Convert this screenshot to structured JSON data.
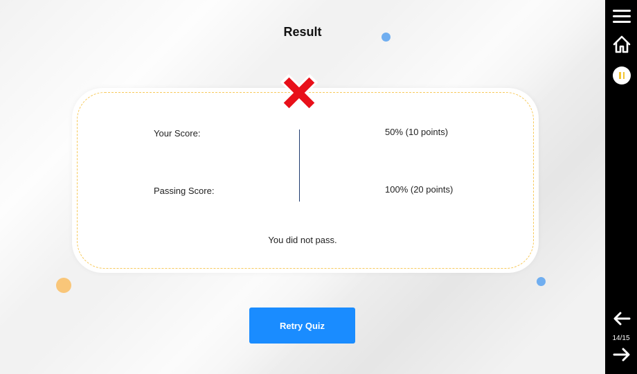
{
  "header": {
    "title": "Result"
  },
  "result": {
    "status_icon": "x-mark-icon",
    "your_score_label": "Your Score:",
    "your_score_value": "50% (10 points)",
    "passing_score_label": "Passing Score:",
    "passing_score_value": "100% (20 points)",
    "message": "You did not pass."
  },
  "actions": {
    "retry_label": "Retry Quiz"
  },
  "sidebar": {
    "menu_icon": "hamburger-menu-icon",
    "home_icon": "home-icon",
    "pause_icon": "pause-icon",
    "back_icon": "arrow-left-icon",
    "page_counter": "14/15",
    "next_icon": "arrow-right-icon"
  },
  "colors": {
    "accent": "#1a8cff",
    "fail": "#e8101a",
    "dashed_border": "#f7c95a",
    "dot_blue": "#70aef0",
    "dot_orange": "#f9c679",
    "pause_yellow": "#f3c531"
  }
}
